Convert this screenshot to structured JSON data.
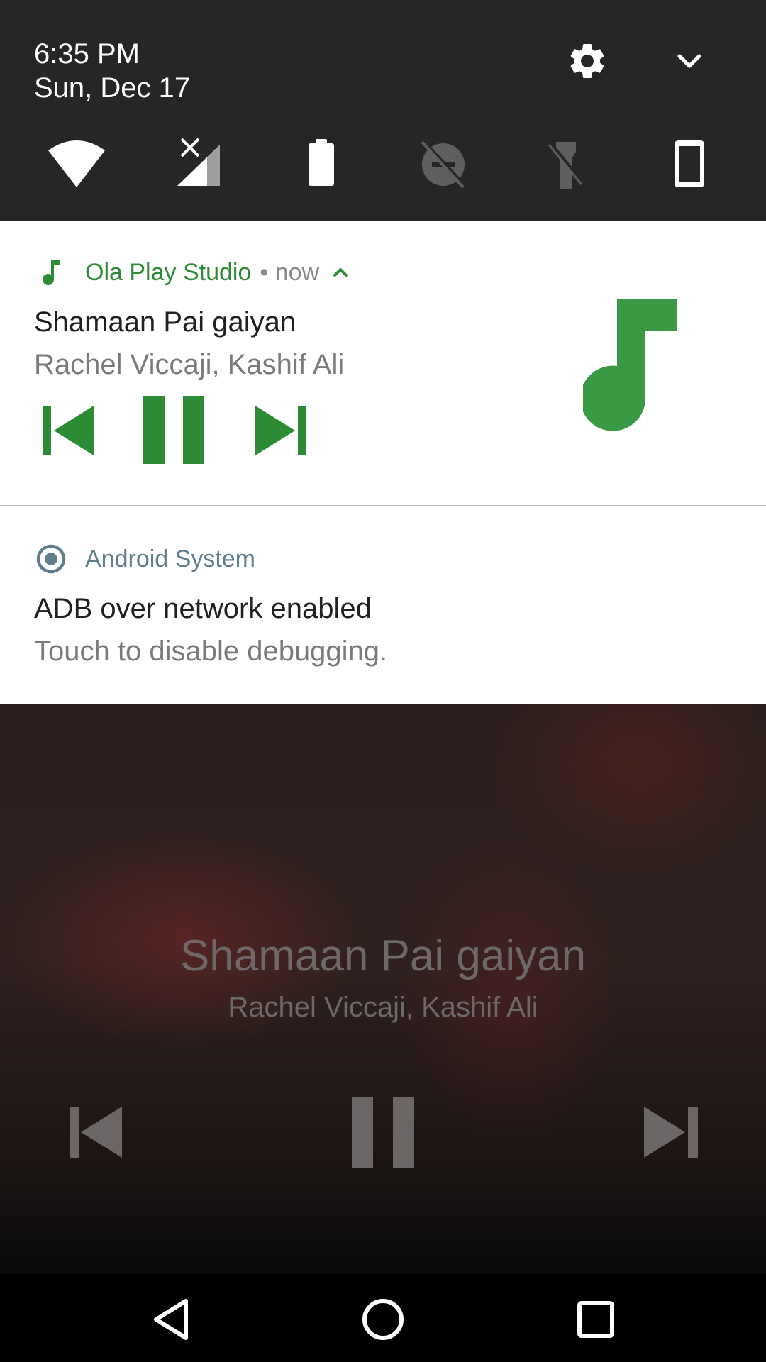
{
  "quick_settings": {
    "time": "6:35 PM",
    "date": "Sun, Dec 17",
    "tiles": [
      "wifi-icon",
      "cellular-signal-off-icon",
      "battery-icon",
      "do-not-disturb-off-icon",
      "flashlight-off-icon",
      "auto-rotate-portrait-icon"
    ],
    "settings_icon": "gear-icon",
    "expand_icon": "chevron-down-icon"
  },
  "music_notification": {
    "app_name": "Ola Play Studio",
    "time": "• now",
    "title": "Shamaan Pai gaiyan",
    "artist": "Rachel Viccaji, Kashif Ali",
    "accent_color": "#2e8b35",
    "icon": "music-note-icon"
  },
  "system_notification": {
    "app_name": "Android System",
    "title": "ADB over network enabled",
    "text": "Touch to disable debugging.",
    "accent_color": "#607d8b"
  },
  "media_background": {
    "title": "Shamaan Pai gaiyan",
    "artist": "Rachel Viccaji, Kashif Ali"
  },
  "navbar": {
    "buttons": [
      "back-icon",
      "home-icon",
      "recents-icon"
    ]
  }
}
